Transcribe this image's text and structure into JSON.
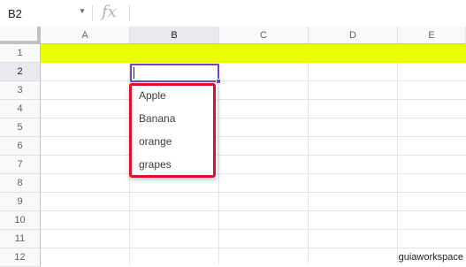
{
  "formula_bar": {
    "cell_reference": "B2",
    "fx_label": "fx",
    "formula_value": ""
  },
  "columns": [
    "A",
    "B",
    "C",
    "D",
    "E"
  ],
  "rows": [
    "1",
    "2",
    "3",
    "4",
    "5",
    "6",
    "7",
    "8",
    "9",
    "10",
    "11",
    "12"
  ],
  "selected": {
    "column": "B",
    "row": "2"
  },
  "colors": {
    "row1_fill": "#eaff00",
    "selection": "#7b3fc6",
    "highlight_frame": "#e0102a"
  },
  "dropdown": {
    "options": [
      "Apple",
      "Banana",
      "orange",
      "grapes"
    ]
  },
  "watermark": "guiaworkspace"
}
